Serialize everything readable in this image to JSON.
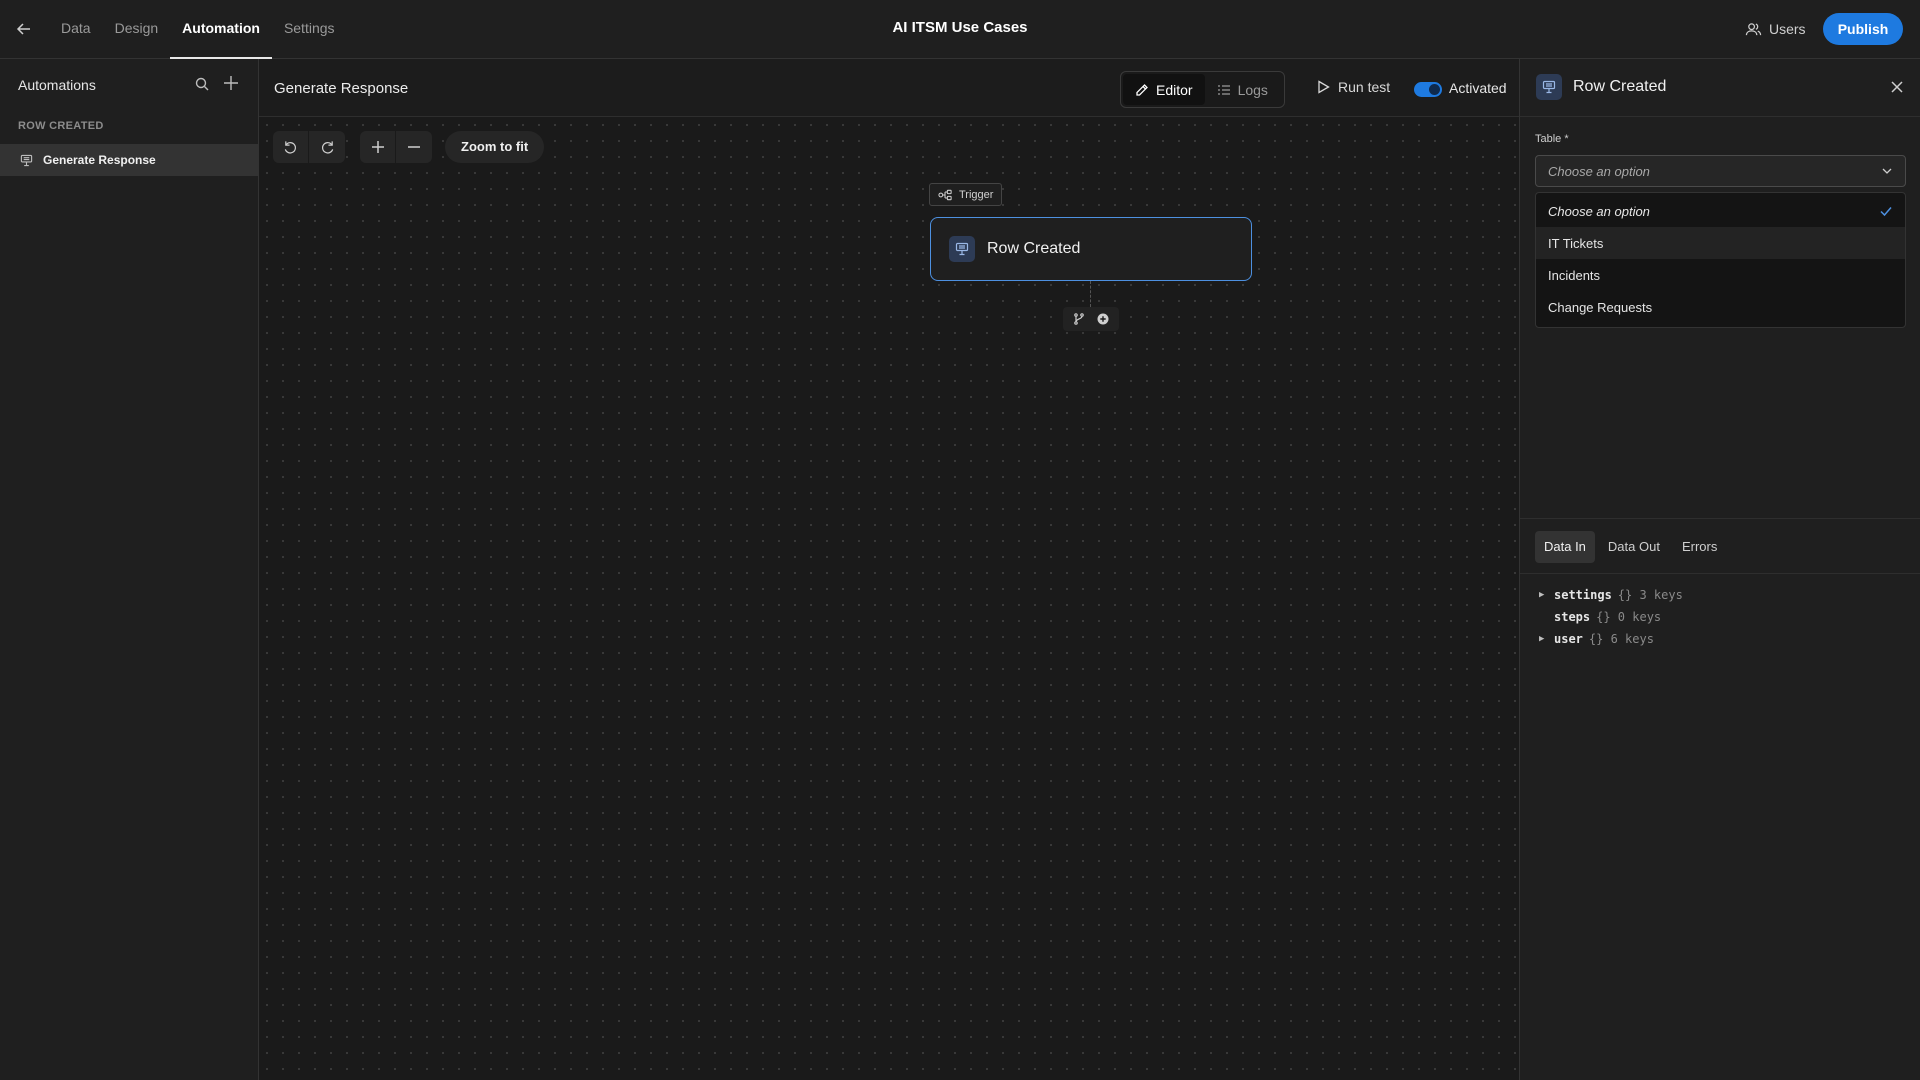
{
  "header": {
    "nav": [
      "Data",
      "Design",
      "Automation",
      "Settings"
    ],
    "active_nav": "Automation",
    "app_title": "AI ITSM Use Cases",
    "users_label": "Users",
    "publish_label": "Publish"
  },
  "sidebar": {
    "title": "Automations",
    "group_label": "ROW CREATED",
    "items": [
      {
        "label": "Generate Response"
      }
    ]
  },
  "canvas": {
    "automation_title": "Generate Response",
    "editor_label": "Editor",
    "logs_label": "Logs",
    "run_test_label": "Run test",
    "activated_label": "Activated",
    "activated": true,
    "zoom_fit_label": "Zoom to fit",
    "trigger_label": "Trigger",
    "node_label": "Row Created"
  },
  "panel": {
    "title": "Row Created",
    "table_label": "Table *",
    "table_placeholder": "Choose an option",
    "options": [
      "Choose an option",
      "IT Tickets",
      "Incidents",
      "Change Requests"
    ],
    "tabs": [
      "Data In",
      "Data Out",
      "Errors"
    ],
    "active_tab": "Data In",
    "tree": [
      {
        "key": "settings",
        "meta": "{} 3 keys",
        "expandable": true
      },
      {
        "key": "steps",
        "meta": "{} 0 keys",
        "expandable": false
      },
      {
        "key": "user",
        "meta": "{} 6 keys",
        "expandable": true
      }
    ]
  },
  "colors": {
    "accent": "#1e7ae0",
    "node_border": "#4d90e0",
    "background": "#1a1a1a"
  }
}
